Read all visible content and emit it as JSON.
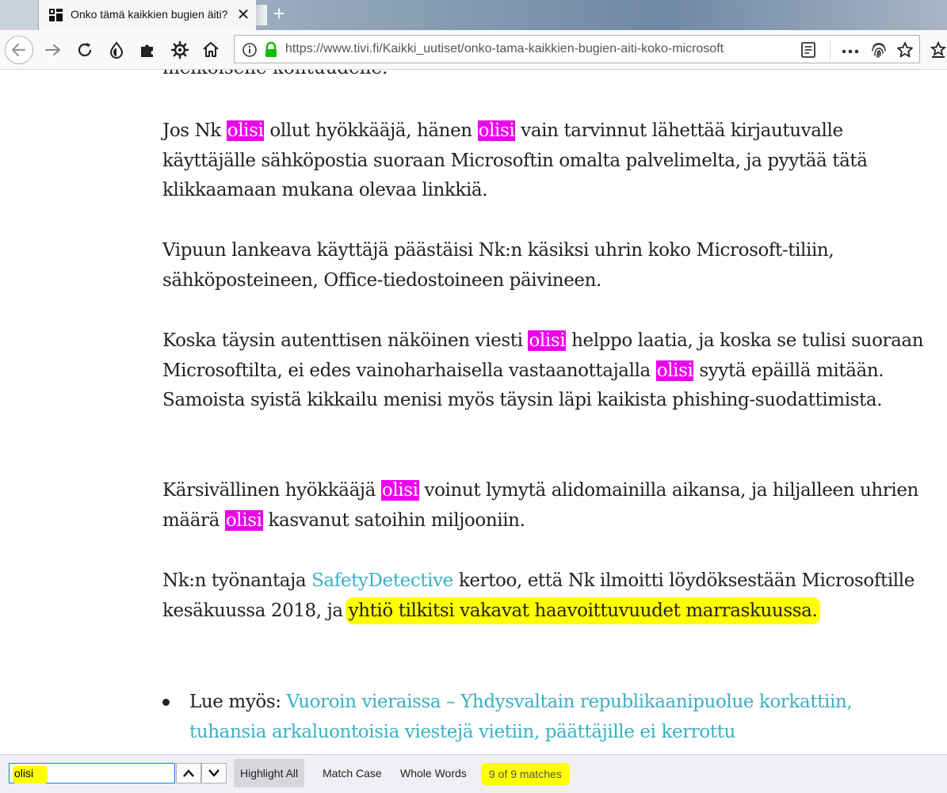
{
  "browser": {
    "tab": {
      "title": "Onko tämä kaikkien bugien äiti?",
      "close_glyph": "✕",
      "favicon_icon": "tivi-logo-icon"
    },
    "new_tab_glyph": "+",
    "toolbar_icons": [
      "back-icon",
      "forward-icon",
      "reload-icon",
      "vpn-drop-icon",
      "extensions-icon",
      "settings-gear-icon",
      "home-icon"
    ],
    "url": "https://www.tivi.fi/Kaikki_uutiset/onko-tama-kaikkien-bugien-aiti-koko-microsoft",
    "url_icons": [
      "info-icon",
      "lock-icon",
      "reader-view-icon",
      "page-actions-icon",
      "fingerprint-icon",
      "bookmark-star-icon"
    ]
  },
  "article": {
    "cut_line": "melkoiselle kohtuudelle.",
    "p1": {
      "a": "Jos Nk ",
      "m1": "olisi",
      "b": " ollut hyökkääjä, hänen ",
      "m2": "olisi",
      "c": " vain tarvinnut lähettää kirjautuvalle käyttäjälle sähköpostia suoraan Microsoftin omalta palvelimelta, ja pyytää tätä klikkaamaan mukana olevaa linkkiä."
    },
    "p2": "Vipuun lankeava käyttäjä päästäisi Nk:n käsiksi uhrin koko Microsoft-tiliin, sähköposteineen, Office-tiedostoineen päivineen.",
    "p3": {
      "a": "Koska täysin autenttisen näköinen viesti ",
      "m1": "olisi",
      "b": " helppo laatia, ja koska se tulisi suoraan Microsoftilta, ei edes vainoharhaisella vastaanottajalla ",
      "m2": "olisi",
      "c": " syytä epäillä mitään. Samoista syistä kikkailu menisi myös täysin läpi kaikista phishing-suodattimista."
    },
    "p4": {
      "a": "Kärsivällinen hyökkääjä ",
      "m1": "olisi",
      "b": " voinut lymytä alidomainilla aikansa, ja hiljalleen uhrien määrä ",
      "m2": "olisi",
      "c": " kasvanut satoihin miljooniin."
    },
    "p5": {
      "a": "Nk:n työnantaja ",
      "link": "SafetyDetective",
      "b": " kertoo, että Nk ilmoitti löydöksestään Microsoftille kesäkuussa 2018, ja ",
      "highlight": "yhtiö tilkitsi vakavat haavoittuvuudet marraskuussa."
    },
    "related": {
      "prefix": "Lue myös: ",
      "link": "Vuoroin vieraissa – Yhdysvaltain republikaanipuolue korkattiin, tuhansia arkaluontoisia viestejä vietiin, päättäjille ei kerrottu"
    }
  },
  "findbar": {
    "query": "olisi",
    "highlight_all": "Highlight All",
    "match_case": "Match Case",
    "whole_words": "Whole Words",
    "status": "9 of 9 matches",
    "highlight_all_active": true
  },
  "colors": {
    "match_highlight": "#ee00ee",
    "link": "#3ab0c3",
    "annotation_yellow": "#ffff00"
  }
}
